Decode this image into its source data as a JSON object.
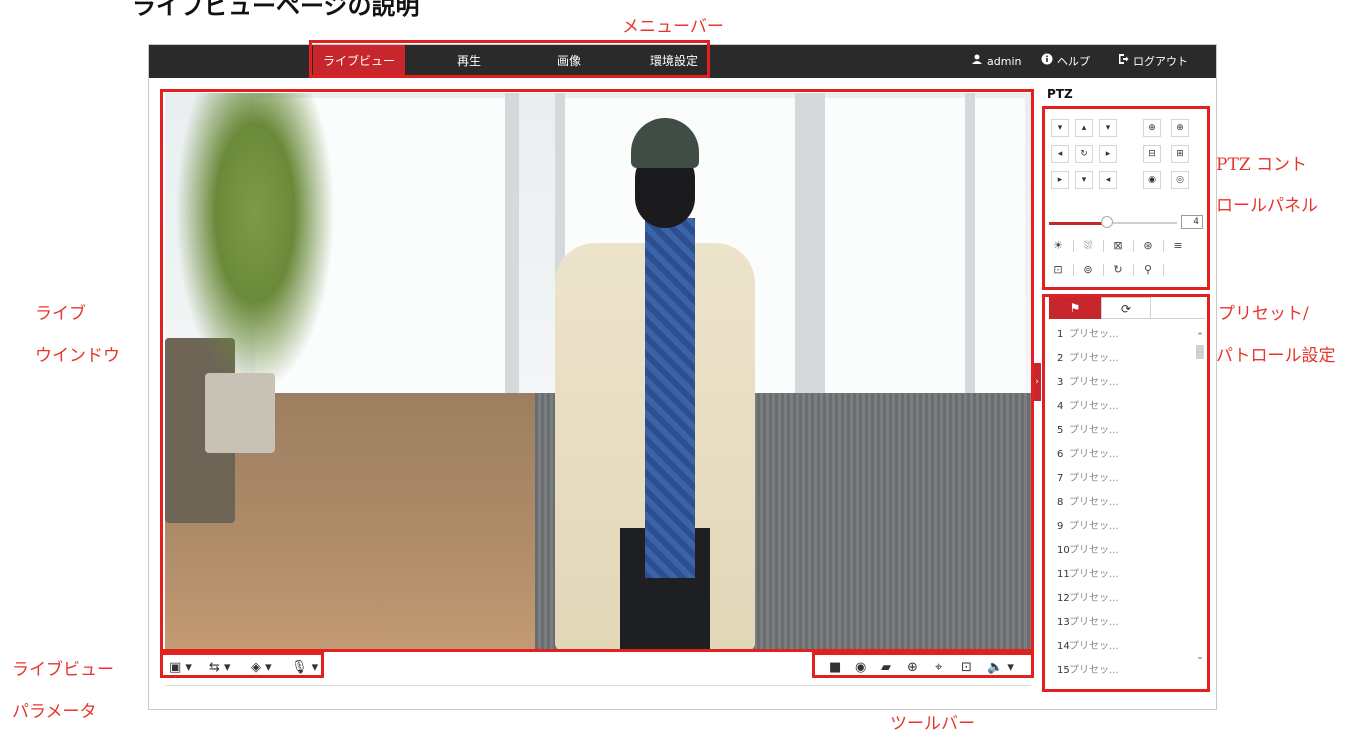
{
  "doc_title": "ライブビューページの説明",
  "annotations": {
    "menu_bar": "メニューバー",
    "ptz_control_1": "PTZ コント",
    "ptz_control_2": "ロールパネル",
    "live_window_1": "ライブ",
    "live_window_2": "ウインドウ",
    "preset_1": "プリセット/",
    "preset_2": "パトロール設定",
    "live_params_1": "ライブビュー",
    "live_params_2": "パラメータ",
    "toolbar": "ツールバー"
  },
  "colors": {
    "accent": "#c6262c",
    "annotation": "#e8342a",
    "topbar": "#2a2a2a"
  },
  "nav": {
    "tabs": [
      {
        "label": "ライブビュー",
        "active": true
      },
      {
        "label": "再生",
        "active": false
      },
      {
        "label": "画像",
        "active": false
      },
      {
        "label": "環境設定",
        "active": false
      }
    ],
    "user_icon": "user-icon",
    "user": "admin",
    "help_icon": "info-icon",
    "help": "ヘルプ",
    "logout_icon": "logout-icon",
    "logout": "ログアウト"
  },
  "live_params": [
    {
      "icon": "window-layout-icon",
      "glyph": "▣"
    },
    {
      "icon": "stream-type-icon",
      "glyph": "⇆"
    },
    {
      "icon": "plugin-icon",
      "glyph": "◈"
    },
    {
      "icon": "microphone-icon",
      "glyph": "🎙"
    }
  ],
  "toolbar": [
    {
      "icon": "stop-live-icon",
      "glyph": "■"
    },
    {
      "icon": "snapshot-icon",
      "glyph": "◉"
    },
    {
      "icon": "record-icon",
      "glyph": "▰"
    },
    {
      "icon": "digital-zoom-icon",
      "glyph": "⊕"
    },
    {
      "icon": "regional-focus-icon",
      "glyph": "⌖"
    },
    {
      "icon": "regional-exposure-icon",
      "glyph": "⊡"
    },
    {
      "icon": "audio-icon",
      "glyph": "🔈"
    }
  ],
  "ptz": {
    "title": "PTZ",
    "directions": [
      "▾",
      "▴",
      "▾",
      "◂",
      "↻",
      "▸",
      "▸",
      "▾",
      "◂"
    ],
    "zoom_focus_iris": [
      "⊕",
      "⊕",
      "⊟",
      "⊞",
      "◉",
      "◎"
    ],
    "speed": "4",
    "speed_level": 0.45,
    "functions": [
      "☀",
      "⛆",
      "⊠",
      "⊛",
      "≡",
      "⊡",
      "⊚",
      "↻",
      "⚲"
    ]
  },
  "preset": {
    "tab_preset_icon": "flag-icon",
    "tab_patrol_icon": "refresh-icon",
    "items": [
      {
        "num": "1",
        "name": "プリセッ..."
      },
      {
        "num": "2",
        "name": "プリセッ..."
      },
      {
        "num": "3",
        "name": "プリセッ..."
      },
      {
        "num": "4",
        "name": "プリセッ..."
      },
      {
        "num": "5",
        "name": "プリセッ..."
      },
      {
        "num": "6",
        "name": "プリセッ..."
      },
      {
        "num": "7",
        "name": "プリセッ..."
      },
      {
        "num": "8",
        "name": "プリセッ..."
      },
      {
        "num": "9",
        "name": "プリセッ..."
      },
      {
        "num": "10",
        "name": "プリセッ..."
      },
      {
        "num": "11",
        "name": "プリセッ..."
      },
      {
        "num": "12",
        "name": "プリセッ..."
      },
      {
        "num": "13",
        "name": "プリセッ..."
      },
      {
        "num": "14",
        "name": "プリセッ..."
      },
      {
        "num": "15",
        "name": "プリセッ..."
      }
    ]
  }
}
